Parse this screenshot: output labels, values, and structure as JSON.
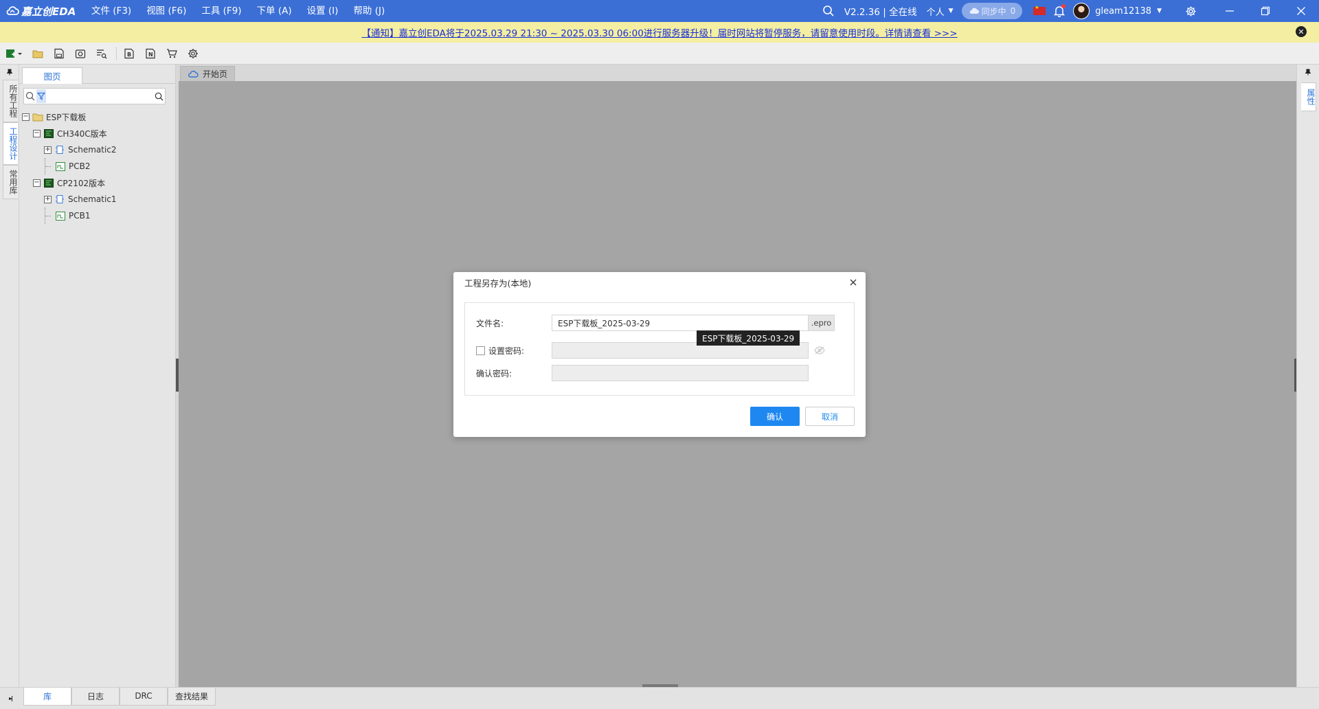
{
  "app": {
    "logo_text": "嘉立创EDA",
    "menu": [
      {
        "label": "文件 (F3)"
      },
      {
        "label": "视图 (F6)"
      },
      {
        "label": "工具 (F9)"
      },
      {
        "label": "下单 (A)"
      },
      {
        "label": "设置 (I)"
      },
      {
        "label": "帮助 (J)"
      }
    ],
    "version_label": "V2.2.36 | 全在线",
    "persona_label": "个人",
    "sync_label": "同步中",
    "sync_count": "0",
    "username": "gleam12138"
  },
  "notice": {
    "text": "【通知】嘉立创EDA将于2025.03.29 21:30 ~ 2025.03.30 06:00进行服务器升级！届时网站将暂停服务，请留意使用时段。详情请查看 >>>"
  },
  "left_strip": {
    "tabs": [
      {
        "label": "所有工程"
      },
      {
        "label": "工程设计"
      },
      {
        "label": "常用库"
      }
    ]
  },
  "left_panel": {
    "tab_label": "图页",
    "search_placeholder": "",
    "tree": [
      {
        "label": "ESP下载板"
      },
      {
        "label": "CH340C版本"
      },
      {
        "label": "Schematic2"
      },
      {
        "label": "PCB2"
      },
      {
        "label": "CP2102版本"
      },
      {
        "label": "Schematic1"
      },
      {
        "label": "PCB1"
      }
    ]
  },
  "doc_tabs": [
    {
      "label": "开始页"
    }
  ],
  "right_strip": {
    "tab_label": "属性"
  },
  "bottom_tabs": [
    {
      "label": "库"
    },
    {
      "label": "日志"
    },
    {
      "label": "DRC"
    },
    {
      "label": "查找结果"
    }
  ],
  "dialog": {
    "title": "工程另存为(本地)",
    "filename_label": "文件名:",
    "filename_value": "ESP下载板_2025-03-29",
    "filename_suffix": ".epro",
    "tooltip": "ESP下载板_2025-03-29",
    "set_password_label": "设置密码:",
    "set_password_checked": false,
    "password_value": "",
    "confirm_password_label": "确认密码:",
    "confirm_password_value": "",
    "ok_label": "确认",
    "cancel_label": "取消"
  },
  "colors": {
    "titlebar": "#3b6fd6",
    "notice_bg": "#f3eea1",
    "canvas": "#a5a5a5",
    "primary": "#1e88f0"
  }
}
